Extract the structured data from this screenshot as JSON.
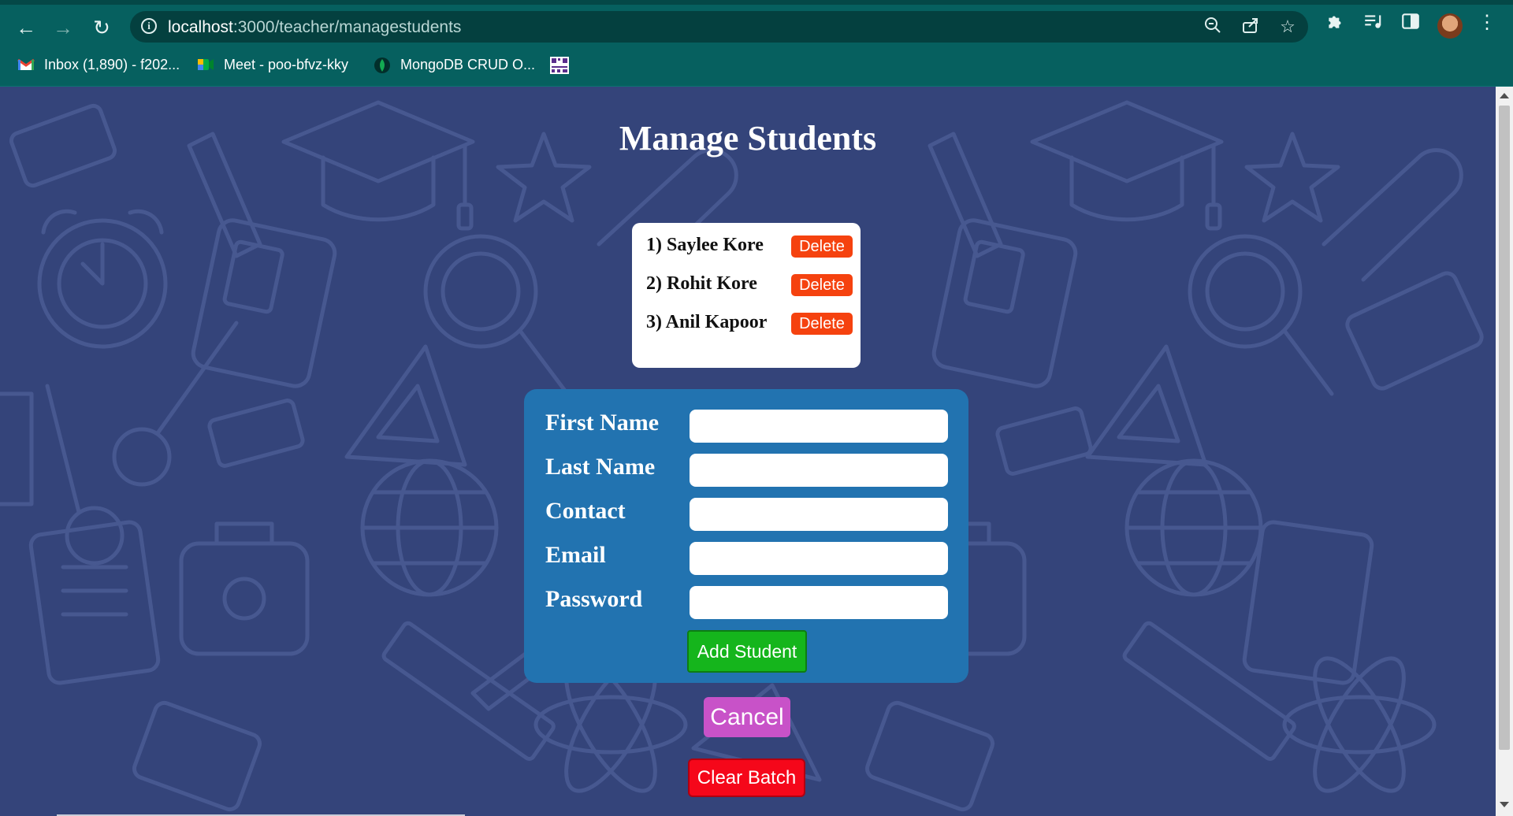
{
  "browser": {
    "url_host": "localhost",
    "url_path": ":3000/teacher/managestudents",
    "bookmarks": [
      {
        "label": "Inbox (1,890) - f202...",
        "icon": "gmail-icon"
      },
      {
        "label": "Meet - poo-bfvz-kky",
        "icon": "meet-icon"
      },
      {
        "label": "MongoDB CRUD O...",
        "icon": "mongodb-icon"
      },
      {
        "label": "",
        "icon": "qr-code-icon"
      }
    ]
  },
  "page": {
    "title": "Manage Students",
    "students": [
      {
        "label": "1) Saylee Kore",
        "action": "Delete"
      },
      {
        "label": "2) Rohit Kore",
        "action": "Delete"
      },
      {
        "label": "3) Anil Kapoor",
        "action": "Delete"
      }
    ],
    "form": {
      "fields": [
        {
          "label": "First Name",
          "value": ""
        },
        {
          "label": "Last Name",
          "value": ""
        },
        {
          "label": "Contact",
          "value": ""
        },
        {
          "label": "Email",
          "value": ""
        },
        {
          "label": "Password",
          "value": ""
        }
      ],
      "submit_label": "Add Student"
    },
    "cancel_label": "Cancel",
    "clear_label": "Clear Batch"
  },
  "colors": {
    "browser_frame": "#06605f",
    "page_background": "#34447a",
    "form_card": "#2273b0",
    "delete_button": "#f5420f",
    "add_button": "#15b51c",
    "cancel_button": "#c852c8",
    "clear_button": "#f5071a"
  }
}
